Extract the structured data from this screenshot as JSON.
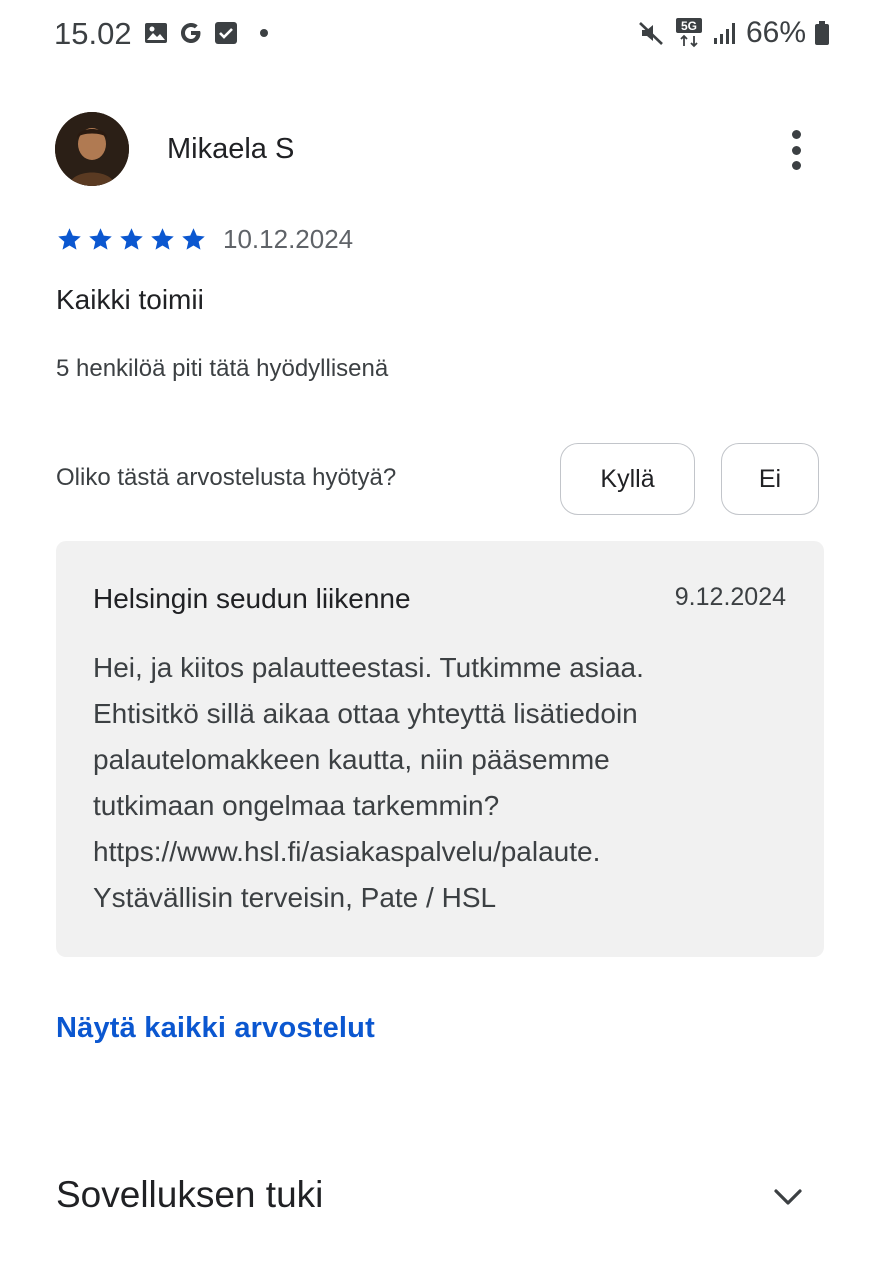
{
  "status_bar": {
    "time": "15.02",
    "network": "5G",
    "battery": "66%"
  },
  "review": {
    "author": "Mikaela S",
    "rating": 5,
    "date": "10.12.2024",
    "text": "Kaikki toimii",
    "helpful_count_text": "5 henkilöä piti tätä hyödyllisenä",
    "helpful_question": "Oliko tästä arvostelusta hyötyä?",
    "yes_label": "Kyllä",
    "no_label": "Ei"
  },
  "developer_reply": {
    "name": "Helsingin seudun liikenne",
    "date": "9.12.2024",
    "lines": [
      "Hei, ja kiitos palautteestasi. Tutkimme asiaa.",
      "Ehtisitkö sillä aikaa ottaa yhteyttä lisätiedoin",
      "palautelomakkeen kautta, niin pääsemme",
      "tutkimaan ongelmaa tarkemmin?",
      "https://www.hsl.fi/asiakaspalvelu/palaute.",
      "Ystävällisin terveisin, Pate / HSL"
    ]
  },
  "links": {
    "all_reviews": "Näytä kaikki arvostelut"
  },
  "app_support": {
    "title": "Sovelluksen tuki"
  },
  "colors": {
    "star": "#0b57d0",
    "link": "#0b57d0",
    "reply_bg": "#f1f1f1"
  }
}
